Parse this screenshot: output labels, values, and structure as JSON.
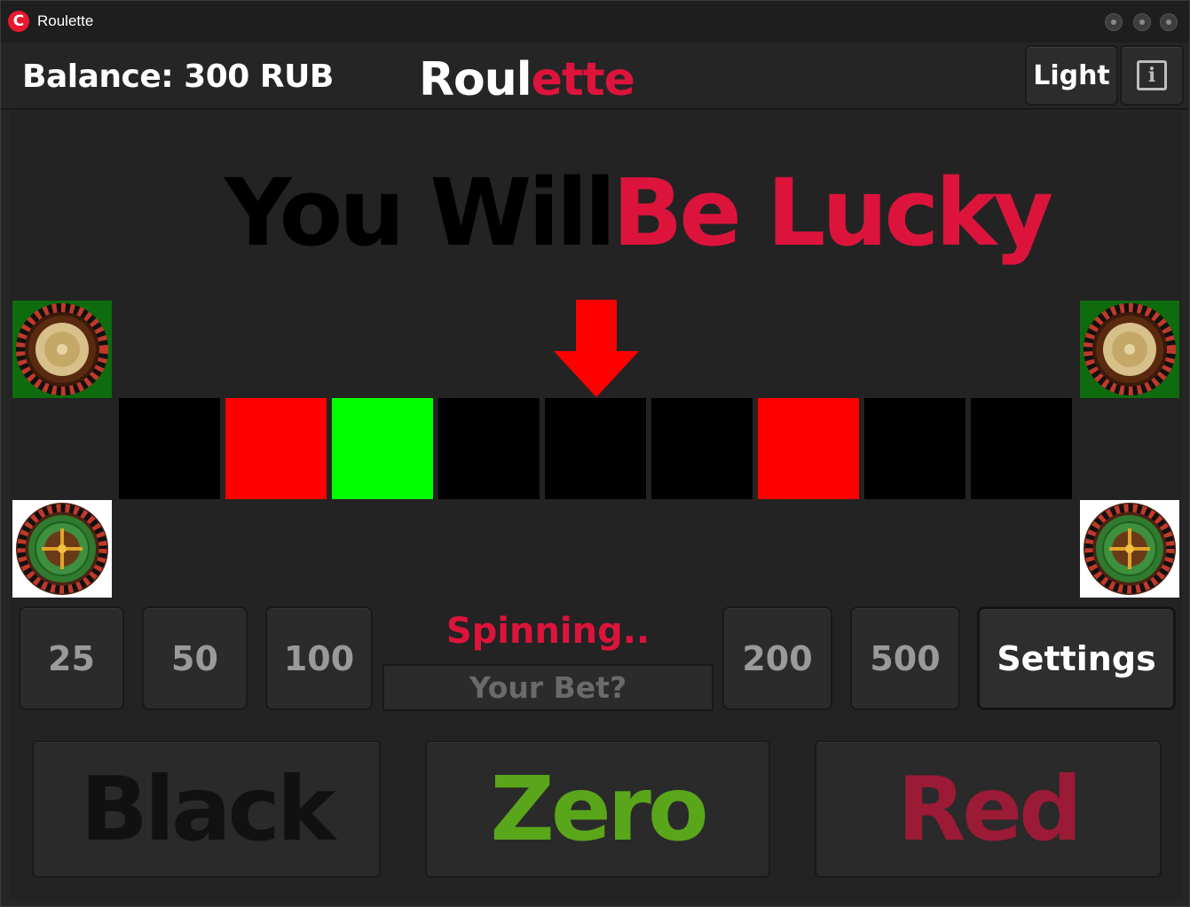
{
  "window": {
    "title": "Roulette",
    "icon_letter": "C",
    "controls": [
      "minimize-icon",
      "maximize-icon",
      "close-icon"
    ]
  },
  "header": {
    "balance": "Balance: 300 RUB",
    "logo_part1": "Roul",
    "logo_part2": "ette",
    "theme_button": "Light",
    "info_icon": "info-icon",
    "info_glyph": "i"
  },
  "headline": {
    "part1": "You Will",
    "part2": "Be Lucky"
  },
  "strip": {
    "cells": [
      "black",
      "red",
      "green",
      "black",
      "black",
      "black",
      "red",
      "black",
      "black"
    ],
    "colors": {
      "black": "#000000",
      "red": "#ff0000",
      "green": "#00ff00"
    },
    "pointer_color": "#ff0000"
  },
  "bets": {
    "amounts_left": [
      "25",
      "50",
      "100"
    ],
    "amounts_right": [
      "200",
      "500"
    ],
    "settings_label": "Settings",
    "status": "Spinning..",
    "input_placeholder": "Your Bet?"
  },
  "choices": {
    "black": "Black",
    "zero": "Zero",
    "red": "Red"
  },
  "colors": {
    "accent": "#dc143c",
    "black_label": "#111111",
    "zero_label": "#5aa61a",
    "red_label": "#9b1a36"
  }
}
